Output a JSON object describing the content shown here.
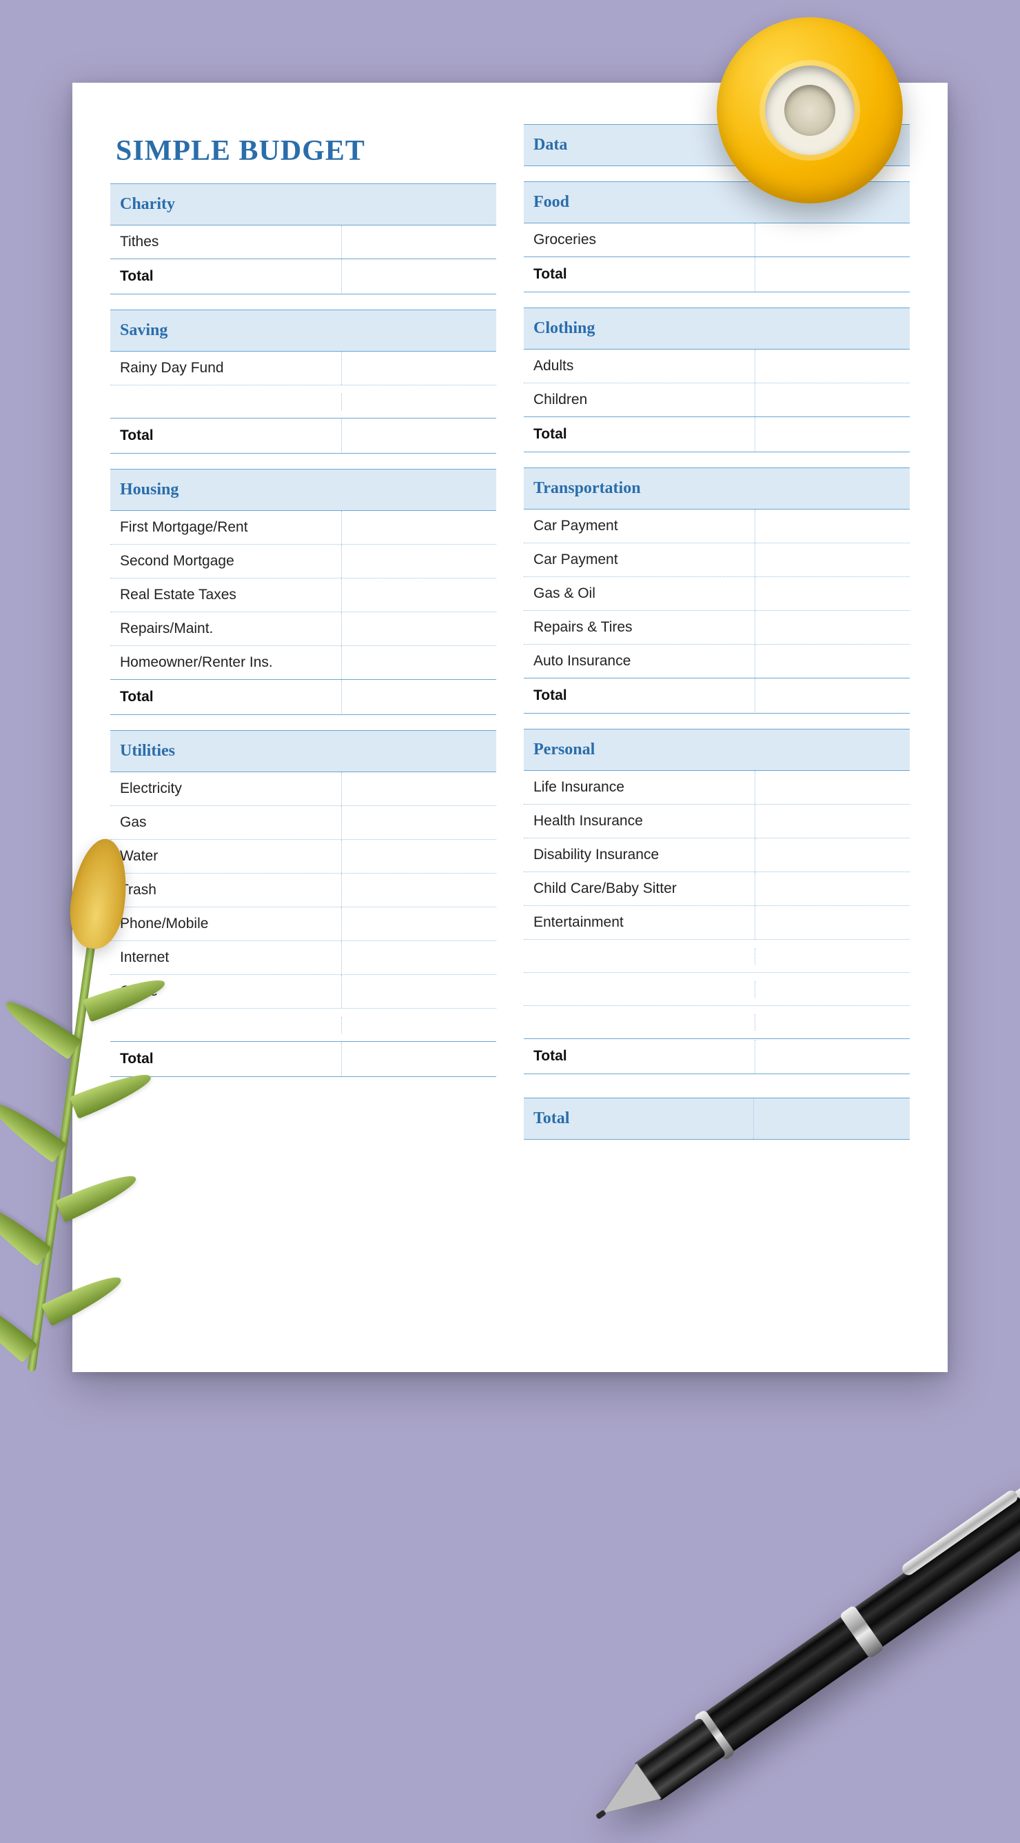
{
  "title": "SIMPLE BUDGET",
  "total_label": "Total",
  "grand_total_label": "Total",
  "colors": {
    "accent": "#2a6daa",
    "header_bg": "#dbe9f5",
    "rule": "#6aa5d2"
  },
  "left": [
    {
      "name": "Charity",
      "items": [
        "Tithes"
      ],
      "blank_rows": 0
    },
    {
      "name": "Saving",
      "items": [
        "Rainy Day Fund"
      ],
      "blank_rows": 1
    },
    {
      "name": "Housing",
      "items": [
        "First Mortgage/Rent",
        "Second Mortgage",
        "Real Estate Taxes",
        "Repairs/Maint.",
        "Homeowner/Renter Ins."
      ],
      "blank_rows": 0
    },
    {
      "name": "Utilities",
      "items": [
        "Electricity",
        "Gas",
        "Water",
        "Trash",
        "Phone/Mobile",
        "Internet",
        "Cable"
      ],
      "blank_rows": 1
    }
  ],
  "right": [
    {
      "name": "Data",
      "header_only": true
    },
    {
      "name": "Food",
      "items": [
        "Groceries"
      ],
      "blank_rows": 0
    },
    {
      "name": "Clothing",
      "items": [
        "Adults",
        "Children"
      ],
      "blank_rows": 0
    },
    {
      "name": "Transportation",
      "items": [
        "Car Payment",
        "Car Payment",
        "Gas & Oil",
        "Repairs & Tires",
        "Auto Insurance"
      ],
      "blank_rows": 0
    },
    {
      "name": "Personal",
      "items": [
        "Life Insurance",
        "Health Insurance",
        "Disability Insurance",
        "Child Care/Baby Sitter",
        "Entertainment"
      ],
      "blank_rows": 3
    }
  ]
}
